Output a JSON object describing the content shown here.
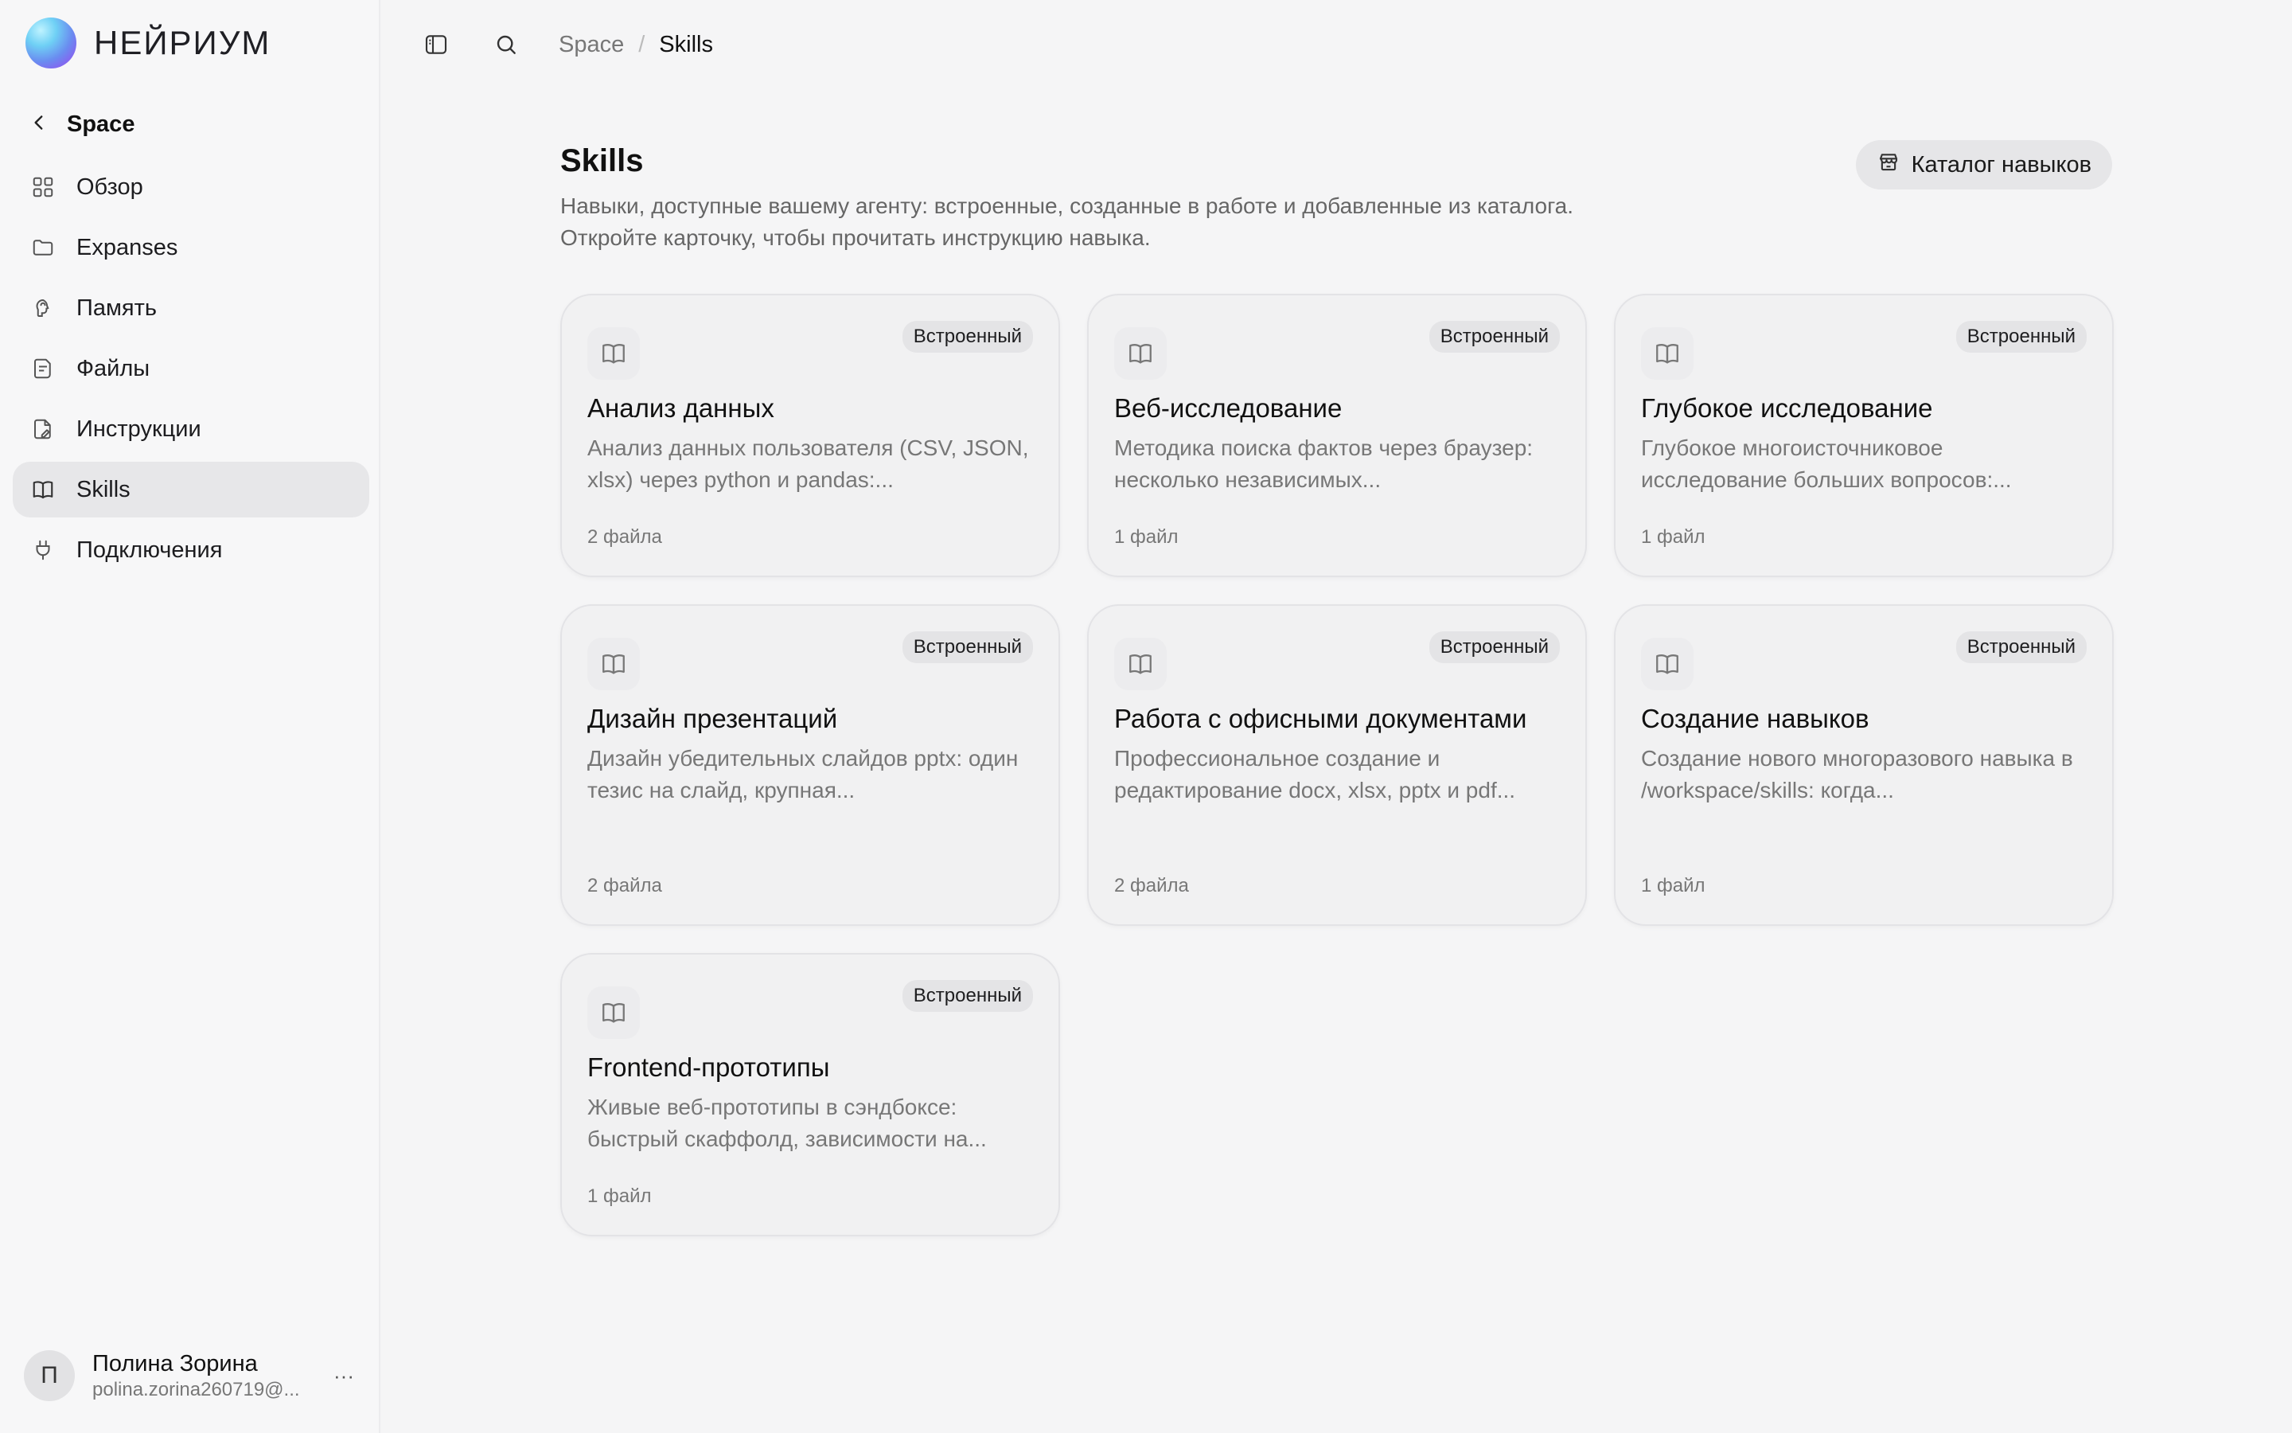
{
  "brand": {
    "name": "НЕЙРИУМ"
  },
  "sidebar": {
    "back_label": "Space",
    "items": [
      {
        "label": "Обзор",
        "icon": "grid-icon"
      },
      {
        "label": "Expanses",
        "icon": "folder-icon"
      },
      {
        "label": "Память",
        "icon": "brain-icon"
      },
      {
        "label": "Файлы",
        "icon": "file-icon"
      },
      {
        "label": "Инструкции",
        "icon": "document-icon"
      },
      {
        "label": "Skills",
        "icon": "book-icon",
        "active": true
      },
      {
        "label": "Подключения",
        "icon": "plug-icon"
      }
    ]
  },
  "user": {
    "initial": "П",
    "name": "Полина Зорина",
    "email": "polina.zorina260719@...",
    "more": "···"
  },
  "breadcrumb": {
    "parent": "Space",
    "separator": "/",
    "current": "Skills"
  },
  "page": {
    "title": "Skills",
    "description": "Навыки, доступные вашему агенту: встроенные, созданные в работе и добавленные из каталога. Откройте карточку, чтобы прочитать инструкцию навыка.",
    "catalog_button": "Каталог навыков"
  },
  "cards": [
    {
      "badge": "Встроенный",
      "title": "Анализ данных",
      "desc": "Анализ данных пользователя (CSV, JSON, xlsx) через python и pandas:...",
      "files": "2 файла"
    },
    {
      "badge": "Встроенный",
      "title": "Веб-исследование",
      "desc": "Методика поиска фактов через браузер: несколько независимых...",
      "files": "1 файл"
    },
    {
      "badge": "Встроенный",
      "title": "Глубокое исследование",
      "desc": "Глубокое многоисточниковое исследование больших вопросов:...",
      "files": "1 файл"
    },
    {
      "badge": "Встроенный",
      "title": "Дизайн презентаций",
      "desc": "Дизайн убедительных слайдов pptx: один тезис на слайд, крупная...",
      "files": "2 файла"
    },
    {
      "badge": "Встроенный",
      "title": "Работа с офисными документами",
      "desc": "Профессиональное создание и редактирование docx, xlsx, pptx и pdf...",
      "files": "2 файла"
    },
    {
      "badge": "Встроенный",
      "title": "Создание навыков",
      "desc": "Создание нового многоразового навыка в /workspace/skills: когда...",
      "files": "1 файл"
    },
    {
      "badge": "Встроенный",
      "title": "Frontend-прототипы",
      "desc": "Живые веб-прототипы в сэндбоксе: быстрый скаффолд, зависимости на...",
      "files": "1 файл"
    }
  ]
}
